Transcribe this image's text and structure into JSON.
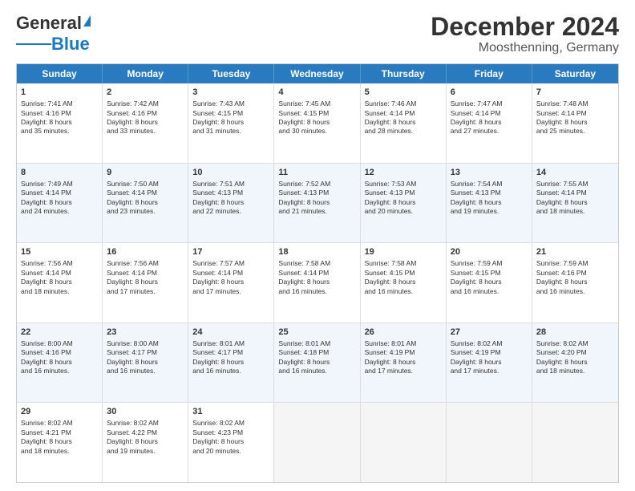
{
  "header": {
    "logo_line1": "General",
    "logo_line2": "Blue",
    "title": "December 2024",
    "subtitle": "Moosthenning, Germany"
  },
  "days": [
    "Sunday",
    "Monday",
    "Tuesday",
    "Wednesday",
    "Thursday",
    "Friday",
    "Saturday"
  ],
  "weeks": [
    [
      {
        "num": "1",
        "lines": [
          "Sunrise: 7:41 AM",
          "Sunset: 4:16 PM",
          "Daylight: 8 hours",
          "and 35 minutes."
        ]
      },
      {
        "num": "2",
        "lines": [
          "Sunrise: 7:42 AM",
          "Sunset: 4:16 PM",
          "Daylight: 8 hours",
          "and 33 minutes."
        ]
      },
      {
        "num": "3",
        "lines": [
          "Sunrise: 7:43 AM",
          "Sunset: 4:15 PM",
          "Daylight: 8 hours",
          "and 31 minutes."
        ]
      },
      {
        "num": "4",
        "lines": [
          "Sunrise: 7:45 AM",
          "Sunset: 4:15 PM",
          "Daylight: 8 hours",
          "and 30 minutes."
        ]
      },
      {
        "num": "5",
        "lines": [
          "Sunrise: 7:46 AM",
          "Sunset: 4:14 PM",
          "Daylight: 8 hours",
          "and 28 minutes."
        ]
      },
      {
        "num": "6",
        "lines": [
          "Sunrise: 7:47 AM",
          "Sunset: 4:14 PM",
          "Daylight: 8 hours",
          "and 27 minutes."
        ]
      },
      {
        "num": "7",
        "lines": [
          "Sunrise: 7:48 AM",
          "Sunset: 4:14 PM",
          "Daylight: 8 hours",
          "and 25 minutes."
        ]
      }
    ],
    [
      {
        "num": "8",
        "lines": [
          "Sunrise: 7:49 AM",
          "Sunset: 4:14 PM",
          "Daylight: 8 hours",
          "and 24 minutes."
        ]
      },
      {
        "num": "9",
        "lines": [
          "Sunrise: 7:50 AM",
          "Sunset: 4:14 PM",
          "Daylight: 8 hours",
          "and 23 minutes."
        ]
      },
      {
        "num": "10",
        "lines": [
          "Sunrise: 7:51 AM",
          "Sunset: 4:13 PM",
          "Daylight: 8 hours",
          "and 22 minutes."
        ]
      },
      {
        "num": "11",
        "lines": [
          "Sunrise: 7:52 AM",
          "Sunset: 4:13 PM",
          "Daylight: 8 hours",
          "and 21 minutes."
        ]
      },
      {
        "num": "12",
        "lines": [
          "Sunrise: 7:53 AM",
          "Sunset: 4:13 PM",
          "Daylight: 8 hours",
          "and 20 minutes."
        ]
      },
      {
        "num": "13",
        "lines": [
          "Sunrise: 7:54 AM",
          "Sunset: 4:13 PM",
          "Daylight: 8 hours",
          "and 19 minutes."
        ]
      },
      {
        "num": "14",
        "lines": [
          "Sunrise: 7:55 AM",
          "Sunset: 4:14 PM",
          "Daylight: 8 hours",
          "and 18 minutes."
        ]
      }
    ],
    [
      {
        "num": "15",
        "lines": [
          "Sunrise: 7:56 AM",
          "Sunset: 4:14 PM",
          "Daylight: 8 hours",
          "and 18 minutes."
        ]
      },
      {
        "num": "16",
        "lines": [
          "Sunrise: 7:56 AM",
          "Sunset: 4:14 PM",
          "Daylight: 8 hours",
          "and 17 minutes."
        ]
      },
      {
        "num": "17",
        "lines": [
          "Sunrise: 7:57 AM",
          "Sunset: 4:14 PM",
          "Daylight: 8 hours",
          "and 17 minutes."
        ]
      },
      {
        "num": "18",
        "lines": [
          "Sunrise: 7:58 AM",
          "Sunset: 4:14 PM",
          "Daylight: 8 hours",
          "and 16 minutes."
        ]
      },
      {
        "num": "19",
        "lines": [
          "Sunrise: 7:58 AM",
          "Sunset: 4:15 PM",
          "Daylight: 8 hours",
          "and 16 minutes."
        ]
      },
      {
        "num": "20",
        "lines": [
          "Sunrise: 7:59 AM",
          "Sunset: 4:15 PM",
          "Daylight: 8 hours",
          "and 16 minutes."
        ]
      },
      {
        "num": "21",
        "lines": [
          "Sunrise: 7:59 AM",
          "Sunset: 4:16 PM",
          "Daylight: 8 hours",
          "and 16 minutes."
        ]
      }
    ],
    [
      {
        "num": "22",
        "lines": [
          "Sunrise: 8:00 AM",
          "Sunset: 4:16 PM",
          "Daylight: 8 hours",
          "and 16 minutes."
        ]
      },
      {
        "num": "23",
        "lines": [
          "Sunrise: 8:00 AM",
          "Sunset: 4:17 PM",
          "Daylight: 8 hours",
          "and 16 minutes."
        ]
      },
      {
        "num": "24",
        "lines": [
          "Sunrise: 8:01 AM",
          "Sunset: 4:17 PM",
          "Daylight: 8 hours",
          "and 16 minutes."
        ]
      },
      {
        "num": "25",
        "lines": [
          "Sunrise: 8:01 AM",
          "Sunset: 4:18 PM",
          "Daylight: 8 hours",
          "and 16 minutes."
        ]
      },
      {
        "num": "26",
        "lines": [
          "Sunrise: 8:01 AM",
          "Sunset: 4:19 PM",
          "Daylight: 8 hours",
          "and 17 minutes."
        ]
      },
      {
        "num": "27",
        "lines": [
          "Sunrise: 8:02 AM",
          "Sunset: 4:19 PM",
          "Daylight: 8 hours",
          "and 17 minutes."
        ]
      },
      {
        "num": "28",
        "lines": [
          "Sunrise: 8:02 AM",
          "Sunset: 4:20 PM",
          "Daylight: 8 hours",
          "and 18 minutes."
        ]
      }
    ],
    [
      {
        "num": "29",
        "lines": [
          "Sunrise: 8:02 AM",
          "Sunset: 4:21 PM",
          "Daylight: 8 hours",
          "and 18 minutes."
        ]
      },
      {
        "num": "30",
        "lines": [
          "Sunrise: 8:02 AM",
          "Sunset: 4:22 PM",
          "Daylight: 8 hours",
          "and 19 minutes."
        ]
      },
      {
        "num": "31",
        "lines": [
          "Sunrise: 8:02 AM",
          "Sunset: 4:23 PM",
          "Daylight: 8 hours",
          "and 20 minutes."
        ]
      },
      null,
      null,
      null,
      null
    ]
  ]
}
